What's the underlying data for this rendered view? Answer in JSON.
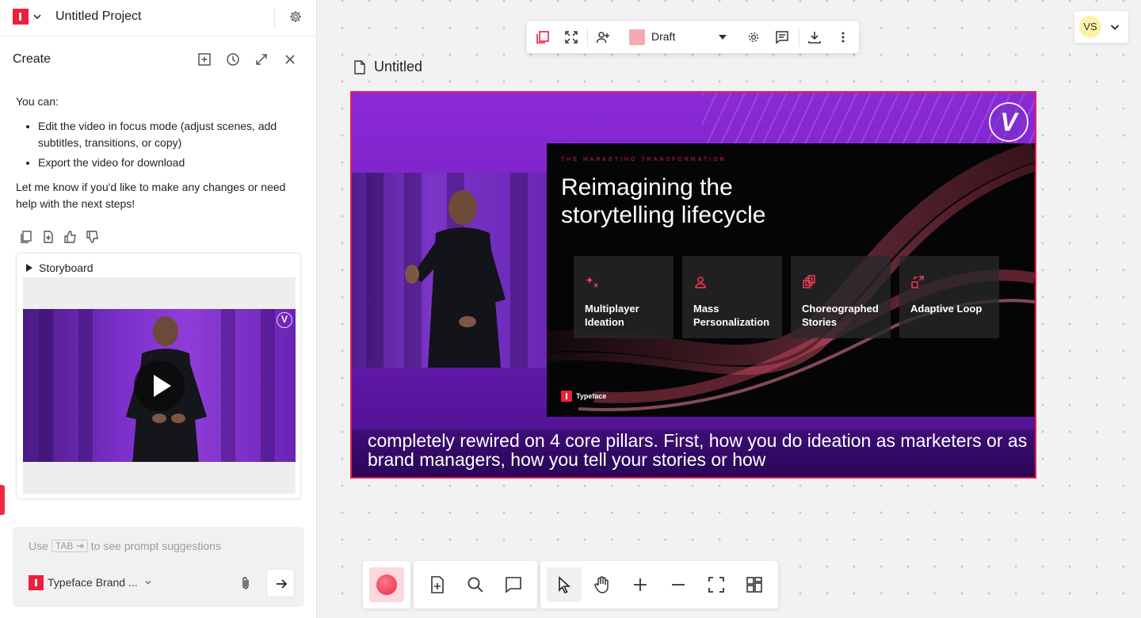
{
  "project": {
    "name": "Untitled Project"
  },
  "panel": {
    "title": "Create",
    "message": {
      "intro": "You can:",
      "bullets": [
        "Edit the video in focus mode (adjust scenes, add subtitles, transitions, or copy)",
        "Export the video for download"
      ],
      "outro": "Let me know if you'd like to make any changes or need help with the next steps!"
    },
    "storyboard_label": "Storyboard",
    "video_logo": "V"
  },
  "prompt": {
    "placeholder_prefix": "Use",
    "placeholder_key": "TAB ⇥",
    "placeholder_suffix": "to see prompt suggestions",
    "brand_label": "Typeface Brand ..."
  },
  "toolbar": {
    "status_label": "Draft",
    "status_color": "#f6a9b4"
  },
  "user": {
    "initials": "VS"
  },
  "document": {
    "title": "Untitled"
  },
  "slide": {
    "kicker": "THE MARKETING TRANSFORMATION",
    "title": "Reimagining the storytelling lifecycle",
    "cards": [
      {
        "label": "Multiplayer Ideation"
      },
      {
        "label": "Mass Personalization"
      },
      {
        "label": "Choreographed Stories"
      },
      {
        "label": "Adaptive Loop"
      }
    ],
    "brand": "Typeface",
    "logo": "V"
  },
  "caption": "completely rewired on 4 core pillars. First, how you do ideation as marketers or as brand managers, how you tell your stories or how",
  "colors": {
    "accent": "#ee1f3b",
    "frame_border": "#e81d49",
    "record": "#e82844"
  }
}
